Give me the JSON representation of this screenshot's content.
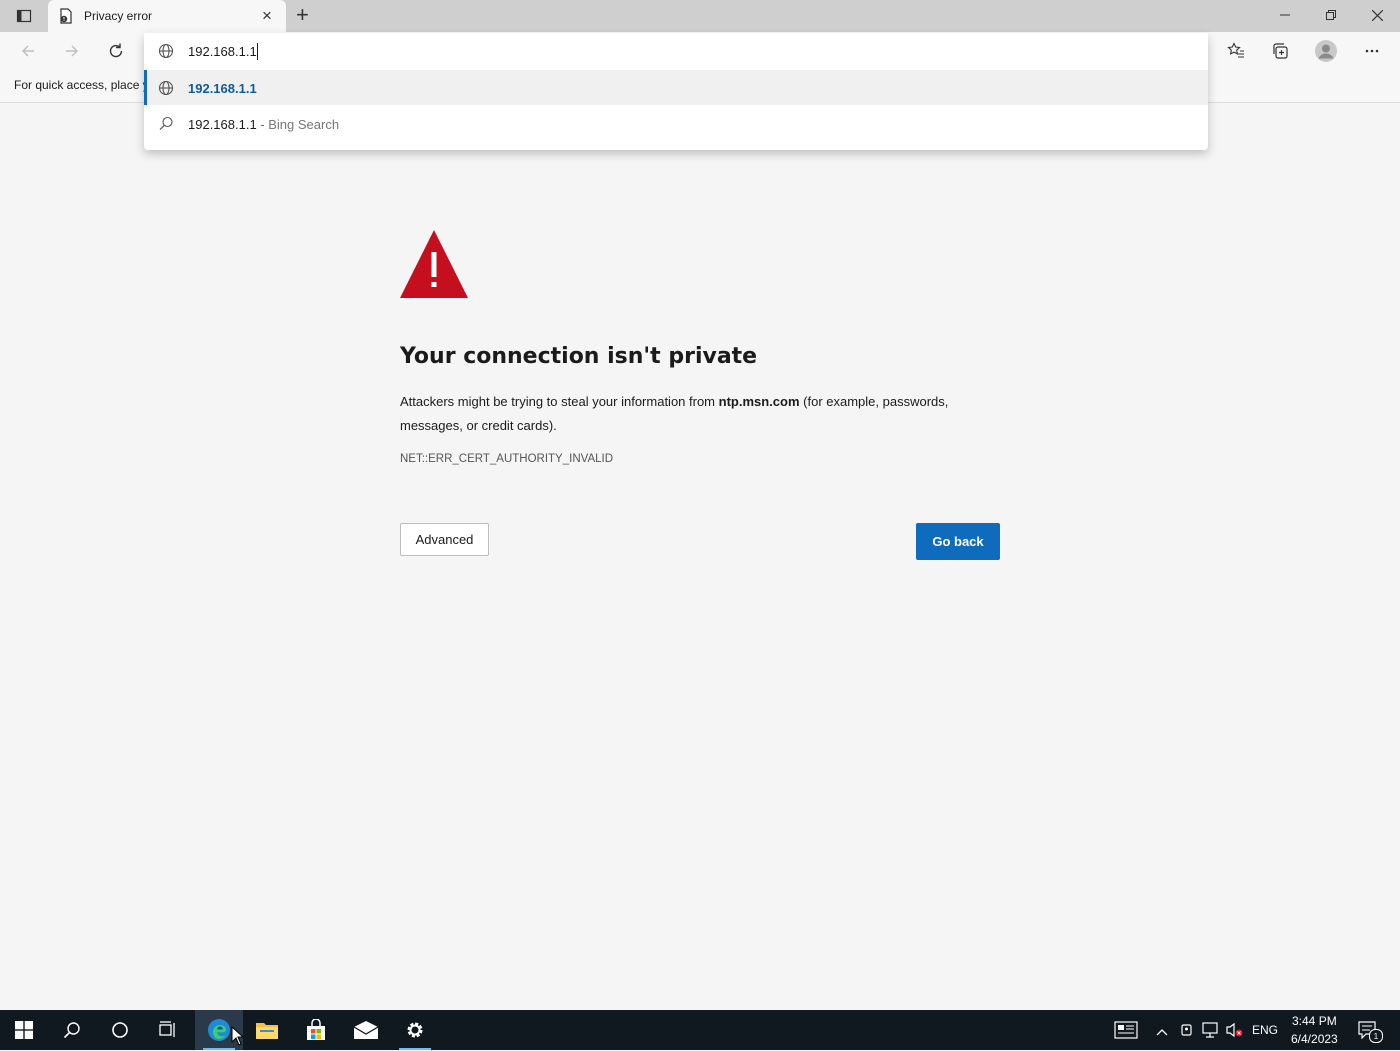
{
  "tab": {
    "title": "Privacy error",
    "close": "×",
    "new_tab": "+"
  },
  "address": {
    "value": "192.168.1.1"
  },
  "suggestions": [
    {
      "text": "192.168.1.1",
      "suffix": ""
    },
    {
      "text": "192.168.1.1",
      "suffix": " - Bing Search"
    }
  ],
  "favorites_bar": {
    "text": "For quick access, place y"
  },
  "error": {
    "heading": "Your connection isn't private",
    "desc_pre": "Attackers might be trying to steal your information from ",
    "domain": "ntp.msn.com",
    "desc_post": " (for example, passwords, messages, or credit cards).",
    "code": "NET::ERR_CERT_AUTHORITY_INVALID",
    "advanced": "Advanced",
    "go_back": "Go back"
  },
  "taskbar": {
    "language": "ENG",
    "time": "3:44 PM",
    "date": "6/4/2023",
    "notification_count": "1"
  },
  "colors": {
    "accent": "#0f6cbd",
    "warning": "#c50f1f",
    "taskbar": "#101820"
  }
}
